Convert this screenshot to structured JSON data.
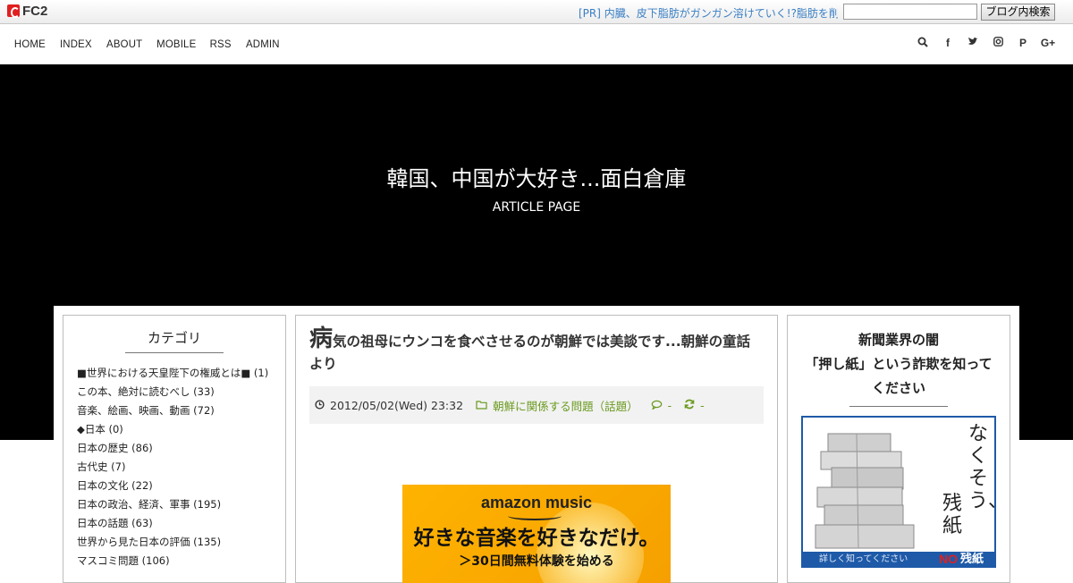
{
  "fc2bar": {
    "logo": "FC2",
    "pr_link": "[PR] 内臓、皮下脂肪がガンガン溶けていく!?脂肪を削",
    "search_value": "",
    "search_button": "ブログ内検索"
  },
  "nav": {
    "items": [
      "HOME",
      "INDEX",
      "ABOUT",
      "MOBILE",
      "RSS",
      "ADMIN"
    ],
    "social": [
      "search-icon",
      "facebook-icon",
      "twitter-icon",
      "instagram-icon",
      "pinterest-icon",
      "google-plus-icon"
    ]
  },
  "hero": {
    "title": "韓国、中国が大好き...面白倉庫",
    "subtitle": "ARTICLE PAGE"
  },
  "sidebar_left": {
    "heading": "カテゴリ",
    "categories": [
      "■世界における天皇陛下の権威とは■ (1)",
      "この本、絶対に読むべし (33)",
      "音楽、絵画、映画、動画 (72)",
      "◆日本 (0)",
      "日本の歴史 (86)",
      "古代史 (7)",
      "日本の文化 (22)",
      "日本の政治、経済、軍事 (195)",
      "日本の話題 (63)",
      "世界から見た日本の評価 (135)",
      "マスコミ問題 (106)"
    ]
  },
  "article": {
    "title_first_char": "病",
    "title_rest": "気の祖母にウンコを食べさせるのが朝鮮では美談です...朝鮮の童話より",
    "date": "2012/05/02(Wed) 23:32",
    "category": "朝鮮に関係する問題（話題）",
    "comments": "-",
    "trackbacks": "-",
    "ad": {
      "brand": "amazon music",
      "headline": "好きな音楽を好きなだけ。",
      "cta": "＞30日間無料体験を始める"
    }
  },
  "sidebar_right": {
    "heading_line1": "新聞業界の闇",
    "heading_line2": "「押し紙」という詐欺を知って",
    "heading_line3": "ください",
    "banner": {
      "vertical_text_1": "なくそう、",
      "vertical_text_2": "残紙",
      "bottom_text": "詳しく知ってください",
      "no_text": "NO",
      "zan_text": "残紙"
    }
  },
  "colors": {
    "link_blue": "#3b7fc4",
    "category_green": "#6a9a1f",
    "hero_bg": "#000000",
    "ad_orange": "#ffb300",
    "banner_blue": "#1e5aa8"
  }
}
